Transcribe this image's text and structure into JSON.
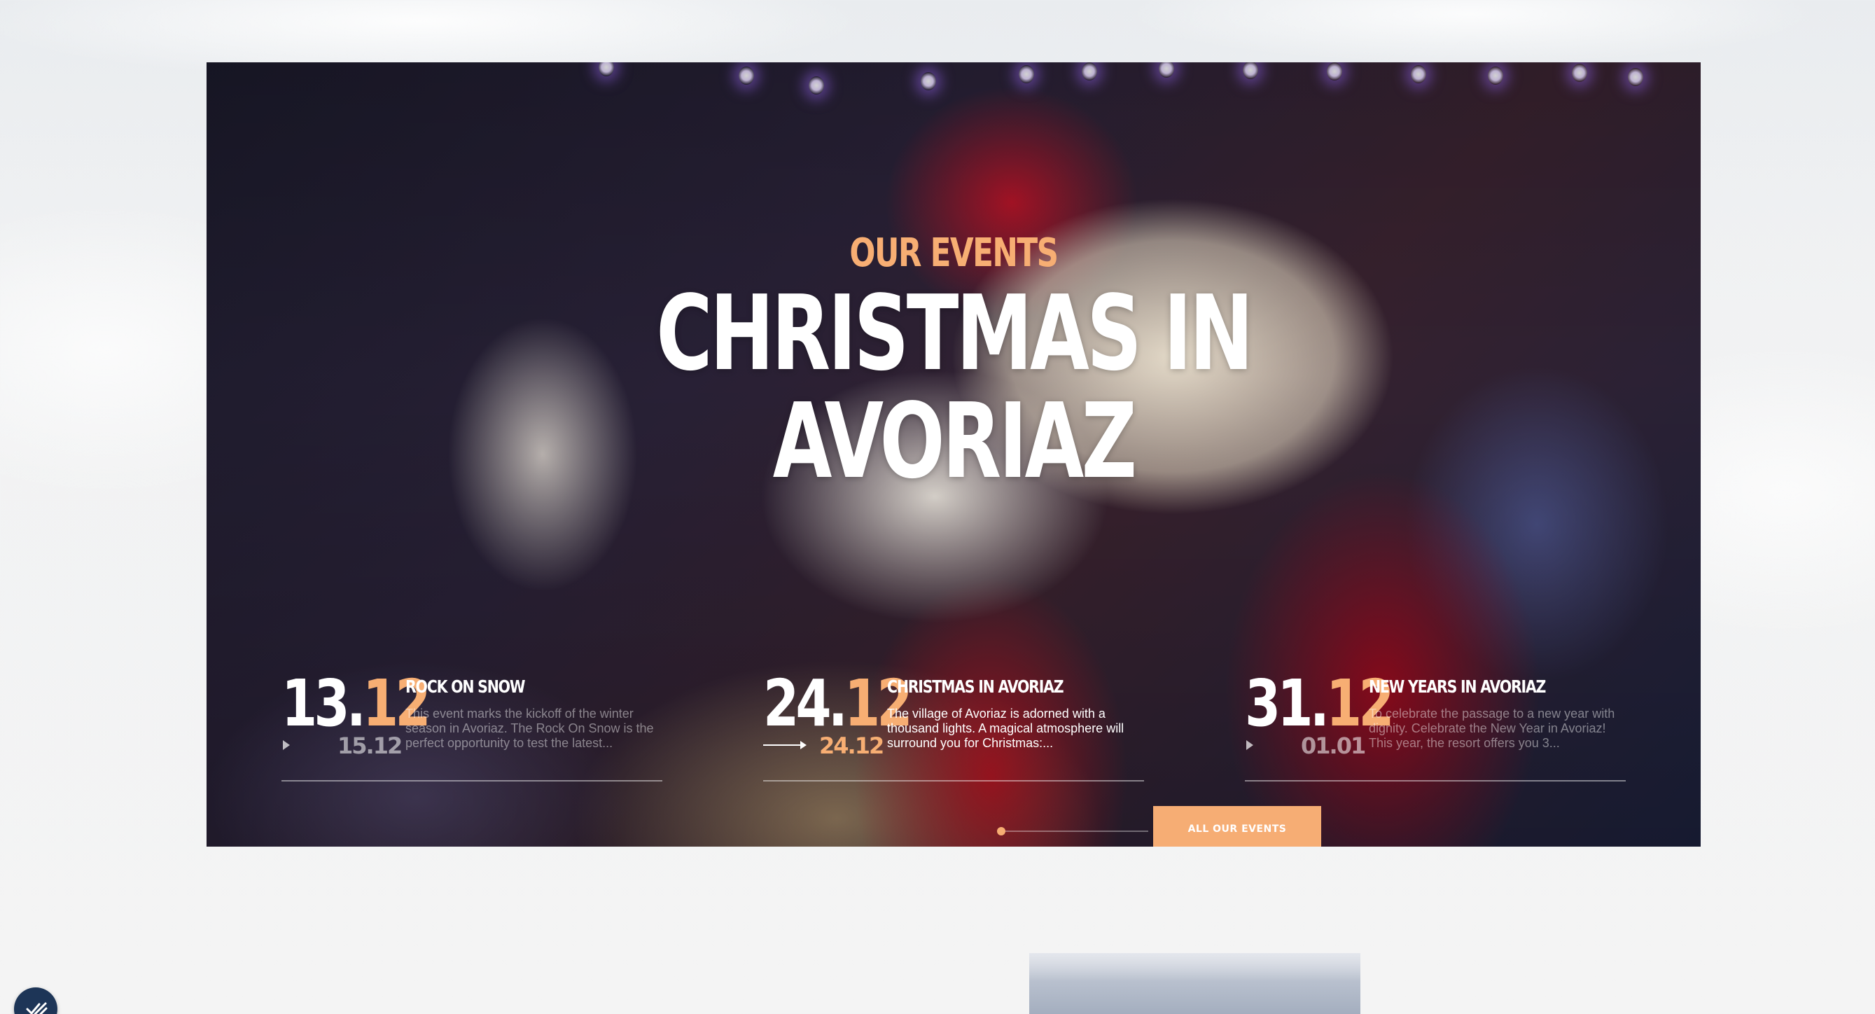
{
  "hero": {
    "kicker": "OUR EVENTS",
    "title": "CHRISTMAS IN AVORIAZ",
    "background_image": "santa-claus-waving",
    "cta_label": "ALL OUR EVENTS",
    "slider_position": 0.0
  },
  "events": [
    {
      "day": "13.",
      "month": "12",
      "end_date": "15.12",
      "title": "ROCK ON SNOW",
      "description": "This event marks the kickoff of the winter season in Avoriaz. The Rock On Snow is the perfect opportunity to test the latest...",
      "active": false
    },
    {
      "day": "24.",
      "month": "12",
      "end_date": "24.12",
      "title": "CHRISTMAS IN AVORIAZ",
      "description": "The village of Avoriaz is adorned with a thousand lights. A magical atmosphere will surround you for Christmas:...",
      "active": true
    },
    {
      "day": "31.",
      "month": "12",
      "end_date": "01.01",
      "title": "NEW YEARS IN AVORIAZ",
      "description": "To celebrate the passage to a new year with dignity. Celebrate the New Year in Avoriaz! This year, the resort offers you 3...",
      "active": false
    }
  ],
  "colors": {
    "accent": "#f7ae73",
    "fab": "#1d3557"
  },
  "icons": {
    "fab_icon": "check-list-icon",
    "play_icon": "play-icon",
    "arrow_icon": "arrow-right-icon"
  }
}
